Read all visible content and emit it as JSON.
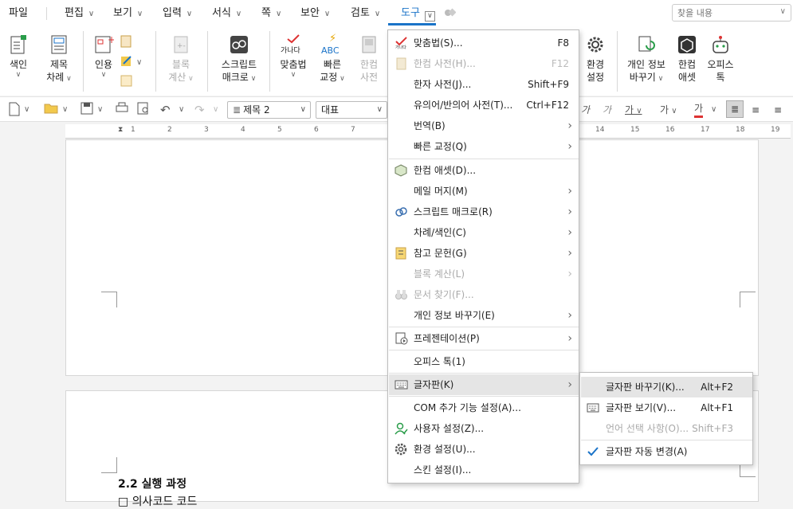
{
  "menubar": {
    "file": "파일",
    "edit": "편집",
    "view": "보기",
    "insert": "입력",
    "format": "서식",
    "page": "쪽",
    "security": "보안",
    "review": "검토",
    "tools": "도구",
    "search_placeholder": "찾을 내용"
  },
  "ribbon": {
    "index": "색인",
    "toc_line1": "제목",
    "toc_line2": "차례",
    "cite": "인용",
    "block_calc_line1": "블록",
    "block_calc_line2": "계산",
    "script_line1": "스크립트",
    "script_line2": "매크로",
    "spell": "맞춤법",
    "spell_icon_text": "가나다",
    "quick_line1": "빠른",
    "quick_line2": "교정",
    "quick_icon_text": "ABC",
    "hanja_line1": "한컴",
    "hanja_line2": "사전",
    "env_line1": "환경",
    "env_line2": "설정",
    "privacy_line1": "개인 정보",
    "privacy_line2": "바꾸기",
    "asset_line1": "한컴",
    "asset_line2": "애셋",
    "office_line1": "오피스",
    "office_line2": "톡"
  },
  "toolbar": {
    "style": "제목 2",
    "font": "대표",
    "italic_a": "가",
    "italic_b": "가",
    "underline": "가",
    "strike": "가",
    "color": "가"
  },
  "ruler": {
    "ticks_left": [
      "1",
      "2",
      "3",
      "4",
      "5",
      "6",
      "7"
    ],
    "ticks_right": [
      "14",
      "15",
      "16",
      "17",
      "18",
      "19"
    ]
  },
  "document": {
    "heading": "2.2  실행  과정",
    "line2": "□ 의사코드 코드"
  },
  "tools_menu": {
    "spell": "맞춤법(S)...",
    "spell_sc": "F8",
    "hancom_dict": "한컴 사전(H)...",
    "hancom_dict_sc": "F12",
    "hanja_dict": "한자 사전(J)...",
    "hanja_dict_sc": "Shift+F9",
    "thesaurus": "유의어/반의어 사전(T)...",
    "thesaurus_sc": "Ctrl+F12",
    "translate": "번역(B)",
    "quick_fix": "빠른 교정(Q)",
    "asset": "한컴 애셋(D)...",
    "mail_merge": "메일 머지(M)",
    "script_macro": "스크립트 매크로(R)",
    "toc_index": "차례/색인(C)",
    "references": "참고 문헌(G)",
    "block_calc": "블록 계산(L)",
    "find_doc": "문서 찾기(F)...",
    "privacy": "개인 정보 바꾸기(E)",
    "presentation": "프레젠테이션(P)",
    "office_talk": "오피스 톡(1)",
    "keyboard": "글자판(K)",
    "com_addin": "COM 추가 기능 설정(A)...",
    "user_settings": "사용자 설정(Z)...",
    "env_settings": "환경 설정(U)...",
    "skin_settings": "스킨 설정(I)..."
  },
  "keyboard_submenu": {
    "change": "글자판 바꾸기(K)...",
    "change_sc": "Alt+F2",
    "show": "글자판 보기(V)...",
    "show_sc": "Alt+F1",
    "lang_select": "언어 선택 사항(O)...",
    "lang_select_sc": "Shift+F3",
    "auto_change": "글자판 자동 변경(A)"
  }
}
